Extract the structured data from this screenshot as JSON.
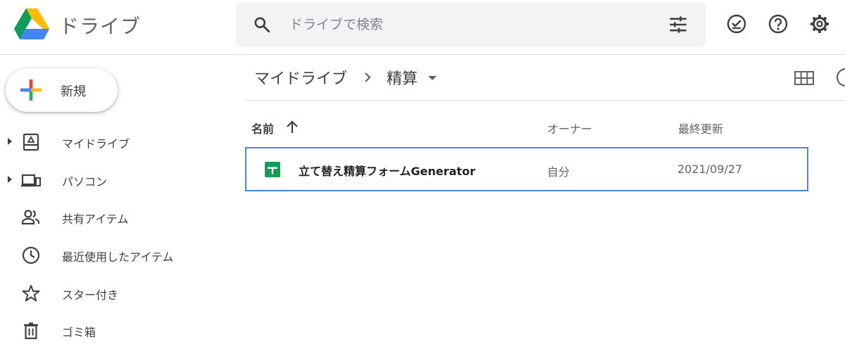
{
  "header": {
    "app_name": "ドライブ",
    "search": {
      "placeholder": "ドライブで検索",
      "value": ""
    }
  },
  "sidebar": {
    "new_button_label": "新規",
    "items": [
      {
        "label": "マイドライブ",
        "icon": "my-drive-icon",
        "expandable": true
      },
      {
        "label": "パソコン",
        "icon": "computers-icon",
        "expandable": true
      },
      {
        "label": "共有アイテム",
        "icon": "shared-icon",
        "expandable": false
      },
      {
        "label": "最近使用したアイテム",
        "icon": "clock-icon",
        "expandable": false
      },
      {
        "label": "スター付き",
        "icon": "star-icon",
        "expandable": false
      },
      {
        "label": "ゴミ箱",
        "icon": "trash-icon",
        "expandable": false
      }
    ]
  },
  "main": {
    "breadcrumb": {
      "root": "マイドライブ",
      "current": "精算"
    },
    "columns": {
      "name": "名前",
      "owner": "オーナー",
      "modified": "最終更新"
    },
    "files": [
      {
        "name": "立て替え精算フォームGenerator",
        "owner": "自分",
        "modified": "2021/09/27",
        "type": "google-sheets"
      }
    ]
  },
  "colors": {
    "selection_border": "#4285f4",
    "sheets_green": "#0f9d58",
    "search_bg": "#f1f3f4",
    "icon_gray": "#5f6368"
  }
}
